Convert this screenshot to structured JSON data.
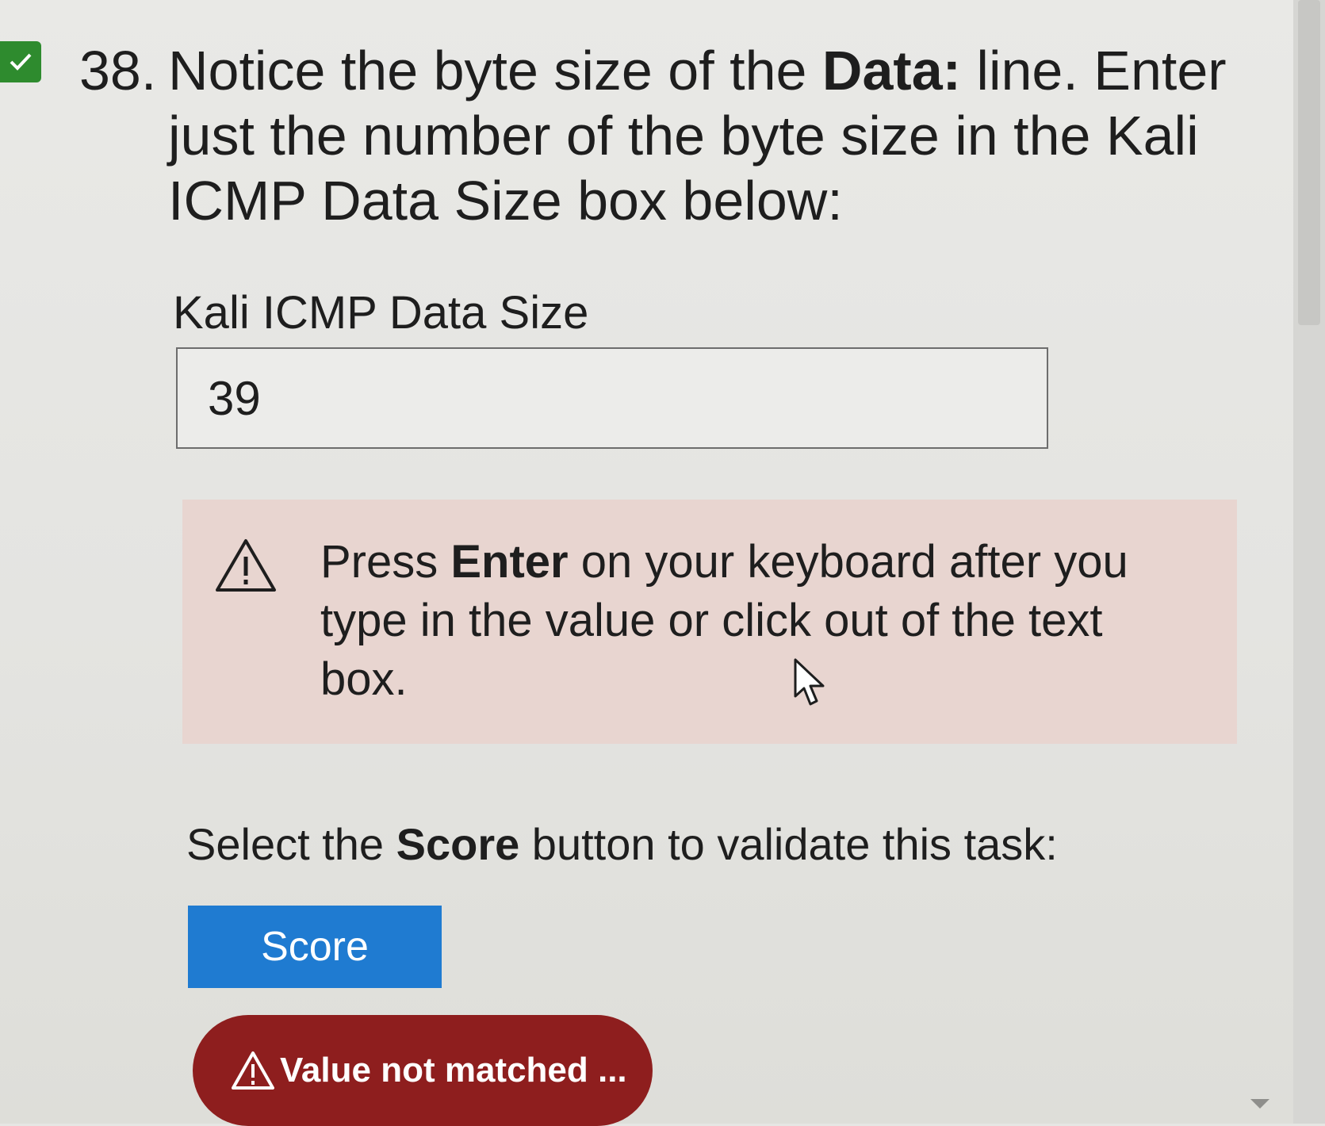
{
  "question": {
    "number": "38.",
    "text_before": "Notice the byte size of the ",
    "text_bold": "Data:",
    "text_after": " line. Enter just the number of the byte size in the Kali ICMP Data Size box below:"
  },
  "field": {
    "label": "Kali ICMP Data Size",
    "value": "39"
  },
  "warning": {
    "icon": "warning-triangle-icon",
    "text_before": "Press ",
    "text_bold": "Enter",
    "text_after": " on your keyboard after you type in the value or click out of the text box."
  },
  "score_instruction": {
    "text_before": "Select the ",
    "text_bold": "Score",
    "text_after": " button to validate this task:"
  },
  "score_button": {
    "label": "Score"
  },
  "status": {
    "icon": "warning-triangle-icon",
    "text": "Value not matched ..."
  },
  "colors": {
    "check": "#2e8b2e",
    "warning_bg": "#e8d5d0",
    "score_button": "#1f7bd1",
    "status_pill": "#8e1e1e"
  }
}
